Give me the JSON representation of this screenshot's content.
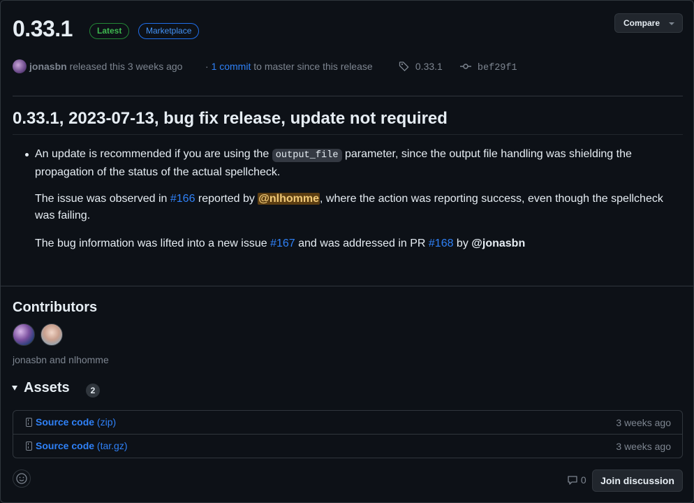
{
  "release": {
    "version": "0.33.1",
    "badges": {
      "latest": "Latest",
      "marketplace": "Marketplace"
    },
    "compare_label": "Compare",
    "author": "jonasbn",
    "released_text": "released this 3 weeks ago",
    "commits_prefix": "·",
    "commits_link": "1 commit",
    "commits_suffix": "to master since this release",
    "tag": "0.33.1",
    "commit_sha": "bef29f1"
  },
  "notes": {
    "heading": "0.33.1, 2023-07-13, bug fix release, update not required",
    "p1_before": "An update is recommended if you are using the ",
    "p1_code": "output_file",
    "p1_after": " parameter, since the output file handling was shielding the propagation of the status of the actual spellcheck.",
    "p2_before": "The issue was observed in ",
    "p2_issue": "#166",
    "p2_middle": " reported by ",
    "p2_mention": "@nlhomme",
    "p2_after": ", where the action was reporting success, even though the spellcheck was failing.",
    "p3_before": "The bug information was lifted into a new issue ",
    "p3_issue": "#167",
    "p3_middle": " and was addressed in PR ",
    "p3_pr": "#168",
    "p3_by": " by ",
    "p3_mention": "@jonasbn"
  },
  "contributors": {
    "heading": "Contributors",
    "names": "jonasbn and nlhomme"
  },
  "assets": {
    "heading": "Assets",
    "count": "2",
    "items": [
      {
        "name": "Source code",
        "ext": "(zip)",
        "time": "3 weeks ago"
      },
      {
        "name": "Source code",
        "ext": "(tar.gz)",
        "time": "3 weeks ago"
      }
    ]
  },
  "footer": {
    "comment_count": "0",
    "join_label": "Join discussion"
  },
  "colors": {
    "accent": "#2f81f7",
    "background": "#0d1117",
    "latest_green": "#3fb950",
    "mention_bg": "#5c3e12"
  }
}
